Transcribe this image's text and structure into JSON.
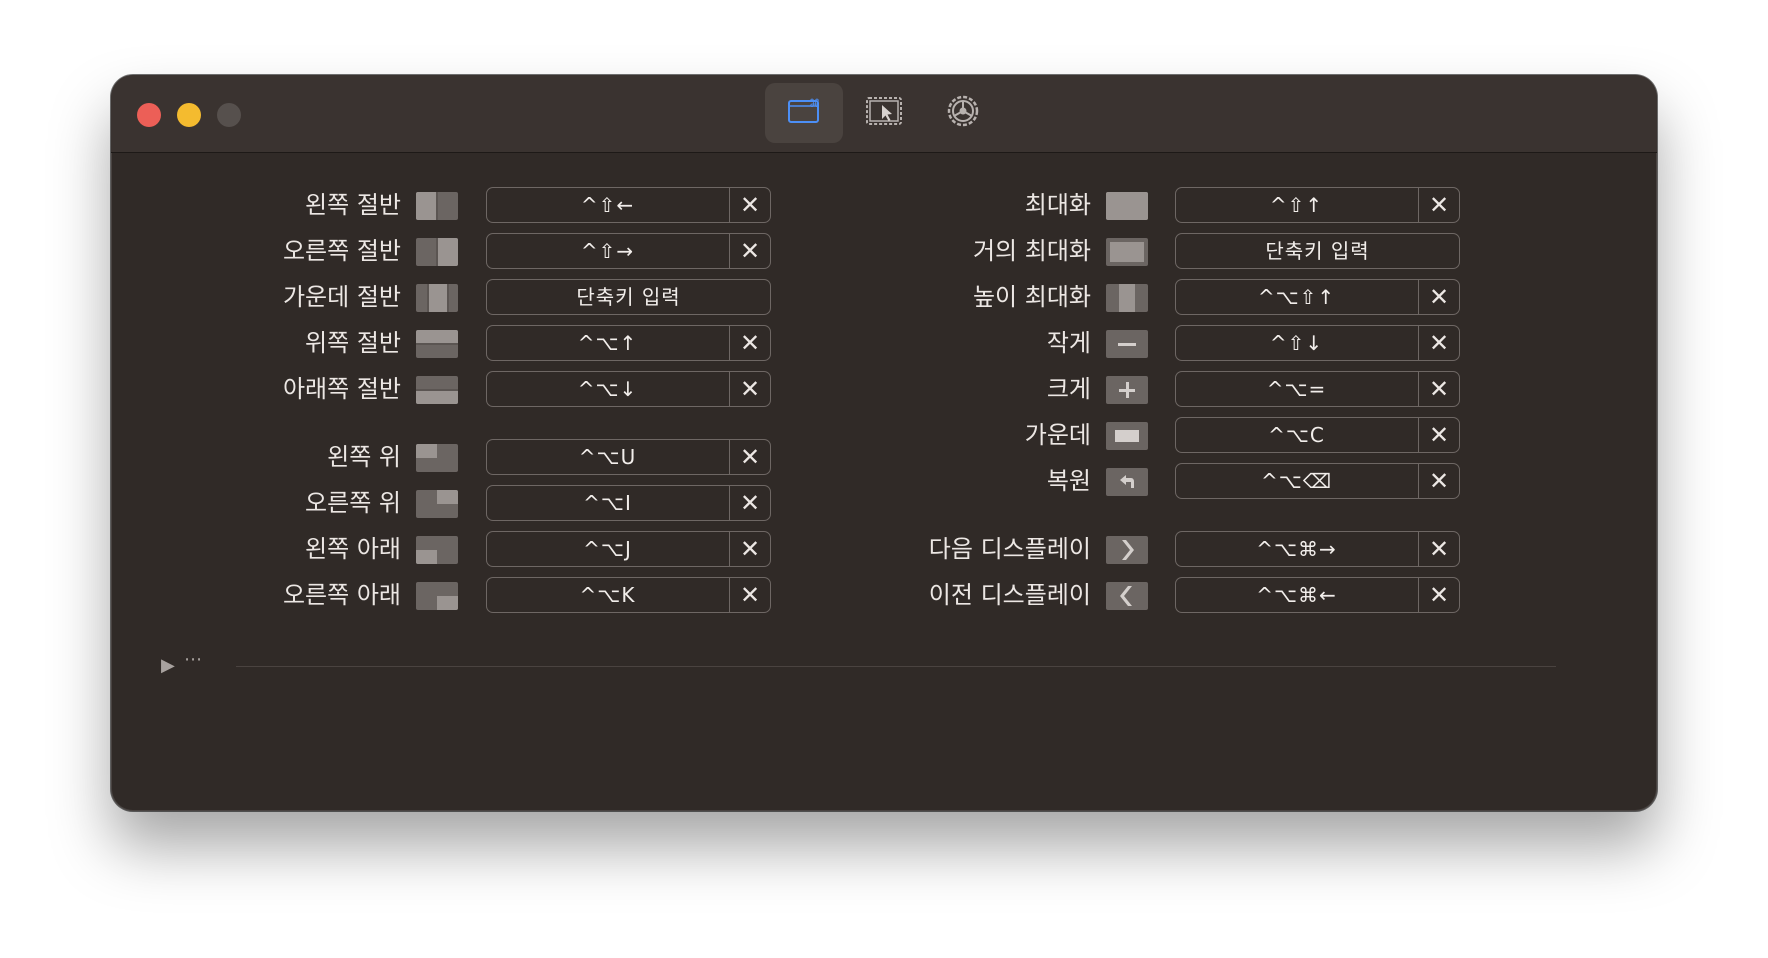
{
  "toolbar": {
    "tabs": [
      {
        "name": "shortcuts-tab",
        "icon": "window-keyboard-icon",
        "active": true
      },
      {
        "name": "snap-areas-tab",
        "icon": "window-cursor-icon",
        "active": false
      },
      {
        "name": "settings-tab",
        "icon": "gear-icon",
        "active": false
      }
    ]
  },
  "left": [
    {
      "label": "왼쪽 절반",
      "shortcut": "^⇧←",
      "clear": "✕",
      "icon": "left-half-icon"
    },
    {
      "label": "오른쪽 절반",
      "shortcut": "^⇧→",
      "clear": "✕",
      "icon": "right-half-icon"
    },
    {
      "label": "가운데 절반",
      "shortcut": "단축키 입력",
      "icon": "center-half-icon"
    },
    {
      "label": "위쪽 절반",
      "shortcut": "^⌥↑",
      "clear": "✕",
      "icon": "top-half-icon"
    },
    {
      "label": "아래쪽 절반",
      "shortcut": "^⌥↓",
      "clear": "✕",
      "icon": "bottom-half-icon"
    },
    {
      "label": "왼쪽 위",
      "shortcut": "^⌥U",
      "clear": "✕",
      "icon": "top-left-icon"
    },
    {
      "label": "오른쪽 위",
      "shortcut": "^⌥I",
      "clear": "✕",
      "icon": "top-right-icon"
    },
    {
      "label": "왼쪽 아래",
      "shortcut": "^⌥J",
      "clear": "✕",
      "icon": "bottom-left-icon"
    },
    {
      "label": "오른쪽 아래",
      "shortcut": "^⌥K",
      "clear": "✕",
      "icon": "bottom-right-icon"
    }
  ],
  "right": [
    {
      "label": "최대화",
      "shortcut": "^⇧↑",
      "clear": "✕",
      "icon": "maximize-icon"
    },
    {
      "label": "거의 최대화",
      "shortcut": "단축키 입력",
      "icon": "almost-maximize-icon"
    },
    {
      "label": "높이 최대화",
      "shortcut": "^⌥⇧↑",
      "clear": "✕",
      "icon": "maximize-height-icon"
    },
    {
      "label": "작게",
      "shortcut": "^⇧↓",
      "clear": "✕",
      "icon": "smaller-icon"
    },
    {
      "label": "크게",
      "shortcut": "^⌥=",
      "clear": "✕",
      "icon": "larger-icon"
    },
    {
      "label": "가운데",
      "shortcut": "^⌥C",
      "clear": "✕",
      "icon": "center-icon"
    },
    {
      "label": "복원",
      "shortcut": "^⌥⌫",
      "clear": "✕",
      "icon": "restore-icon"
    },
    {
      "label": "다음 디스플레이",
      "shortcut": "^⌥⌘→",
      "clear": "✕",
      "icon": "next-display-icon"
    },
    {
      "label": "이전 디스플레이",
      "shortcut": "^⌥⌘←",
      "clear": "✕",
      "icon": "previous-display-icon"
    }
  ],
  "footer": {
    "disclosure": "▶",
    "more": "⋯"
  }
}
